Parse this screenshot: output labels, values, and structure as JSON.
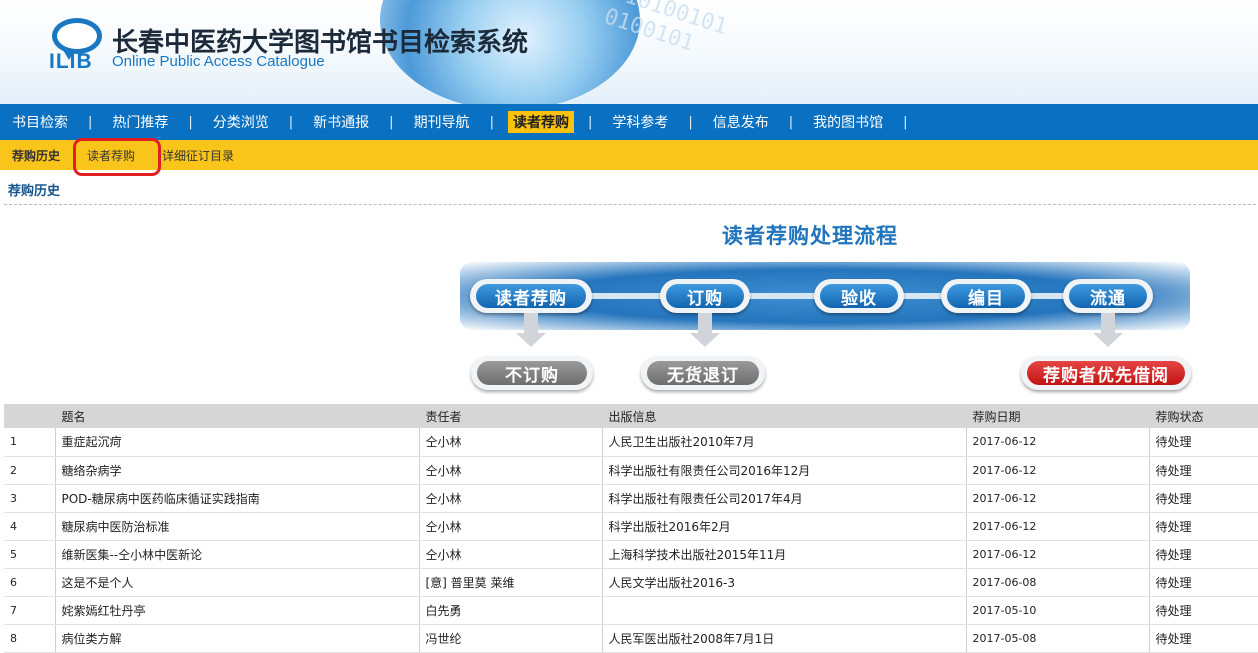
{
  "header": {
    "logo_text": "ILIB",
    "title": "长春中医药大学图书馆书目检索系统",
    "subtitle": "Online Public Access Catalogue"
  },
  "nav": {
    "items": [
      {
        "label": "书目检索"
      },
      {
        "label": "热门推荐"
      },
      {
        "label": "分类浏览"
      },
      {
        "label": "新书通报"
      },
      {
        "label": "期刊导航"
      },
      {
        "label": "读者荐购",
        "active": true
      },
      {
        "label": "学科参考"
      },
      {
        "label": "信息发布"
      },
      {
        "label": "我的图书馆"
      }
    ],
    "separator": "|"
  },
  "subnav": {
    "items": [
      {
        "label": "荐购历史"
      },
      {
        "label": "读者荐购"
      },
      {
        "label": "详细征订目录"
      }
    ]
  },
  "page_title": "荐购历史",
  "flow": {
    "title": "读者荐购处理流程",
    "steps": [
      "读者荐购",
      "订购",
      "验收",
      "编目",
      "流通"
    ],
    "outcomes": [
      "不订购",
      "无货退订",
      "荐购者优先借阅"
    ]
  },
  "table": {
    "headers": [
      "",
      "题名",
      "责任者",
      "出版信息",
      "荐购日期",
      "荐购状态"
    ],
    "rows": [
      {
        "no": "1",
        "title": "重症起沉疴",
        "author": "仝小林",
        "publisher": "人民卫生出版社2010年7月",
        "date": "2017-06-12",
        "status": "待处理"
      },
      {
        "no": "2",
        "title": "糖络杂病学",
        "author": "仝小林",
        "publisher": "科学出版社有限责任公司2016年12月",
        "date": "2017-06-12",
        "status": "待处理"
      },
      {
        "no": "3",
        "title": "POD-糖尿病中医药临床循证实践指南",
        "author": "仝小林",
        "publisher": "科学出版社有限责任公司2017年4月",
        "date": "2017-06-12",
        "status": "待处理"
      },
      {
        "no": "4",
        "title": "糖尿病中医防治标准",
        "author": "仝小林",
        "publisher": "科学出版社2016年2月",
        "date": "2017-06-12",
        "status": "待处理"
      },
      {
        "no": "5",
        "title": "维新医集--仝小林中医新论",
        "author": "仝小林",
        "publisher": "上海科学技术出版社2015年11月",
        "date": "2017-06-12",
        "status": "待处理"
      },
      {
        "no": "6",
        "title": "这是不是个人",
        "author": "[意] 普里莫 莱维",
        "publisher": "人民文学出版社2016-3",
        "date": "2017-06-08",
        "status": "待处理"
      },
      {
        "no": "7",
        "title": "姹紫嫣红牡丹亭",
        "author": "白先勇",
        "publisher": "",
        "date": "2017-05-10",
        "status": "待处理"
      },
      {
        "no": "8",
        "title": "病位类方解",
        "author": "冯世纶",
        "publisher": "人民军医出版社2008年7月1日",
        "date": "2017-05-08",
        "status": "待处理"
      }
    ]
  },
  "colors": {
    "nav_blue": "#0a70c1",
    "subnav_yellow": "#f9c51a",
    "active_tab": "#f8c20f",
    "title_blue": "#1f74bd",
    "highlight_red": "#e02020"
  }
}
